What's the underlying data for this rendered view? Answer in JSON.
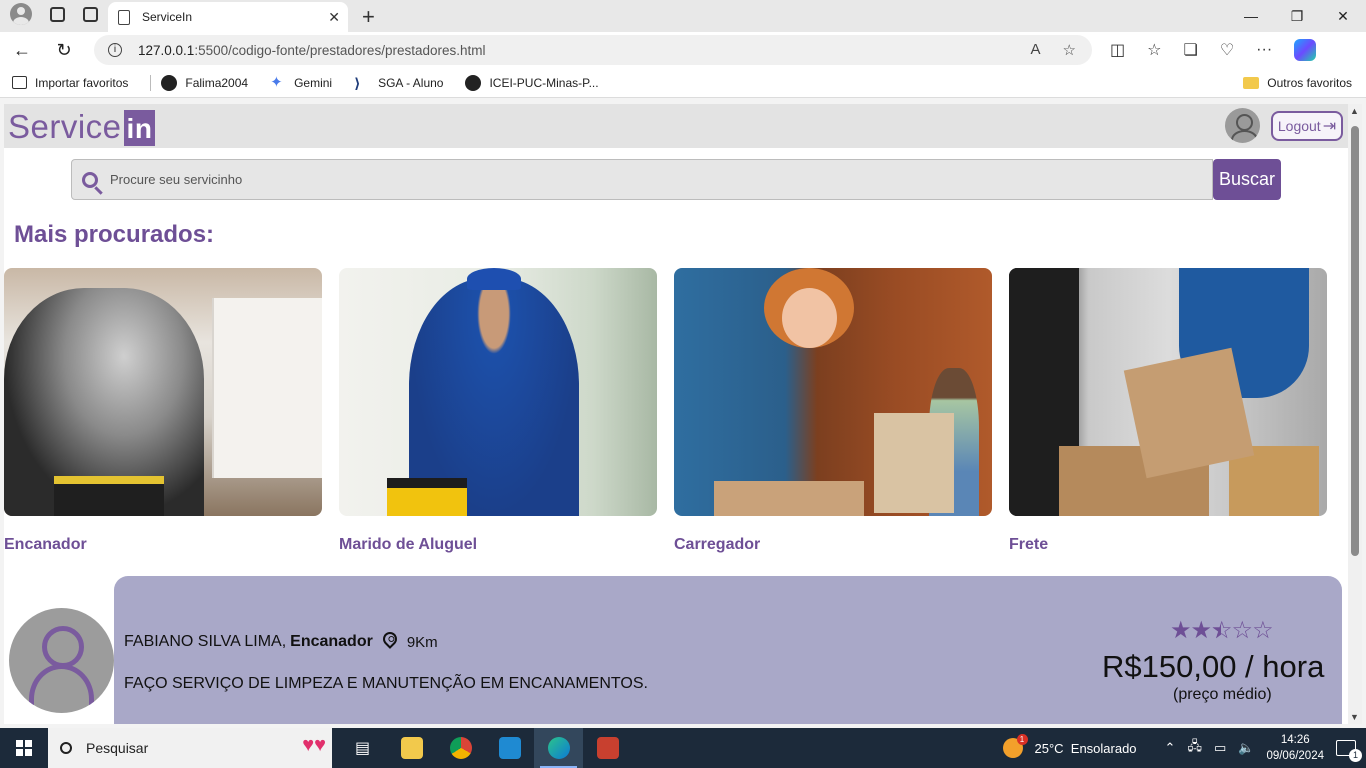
{
  "browser": {
    "tab_title": "ServiceIn",
    "url_host": "127.0.0.1",
    "url_rest": ":5500/codigo-fonte/prestadores/prestadores.html",
    "favorites": [
      {
        "label": "Importar favoritos",
        "icon": "import-icon"
      },
      {
        "label": "Falima2004",
        "icon": "github-icon"
      },
      {
        "label": "Gemini",
        "icon": "gemini-icon"
      },
      {
        "label": "SGA - Aluno",
        "icon": "sga-icon"
      },
      {
        "label": "ICEI-PUC-Minas-P...",
        "icon": "github-icon"
      }
    ],
    "other_favorites": "Outros favoritos"
  },
  "header": {
    "logo_text": "Service",
    "logo_suffix": "in",
    "logout_label": "Logout"
  },
  "search": {
    "placeholder": "Procure seu servicinho",
    "button_label": "Buscar"
  },
  "popular": {
    "title": "Mais procurados:",
    "items": [
      {
        "label": "Encanador"
      },
      {
        "label": "Marido de Aluguel"
      },
      {
        "label": "Carregador"
      },
      {
        "label": "Frete"
      }
    ]
  },
  "provider": {
    "name": "FABIANO SILVA LIMA,",
    "service": "Encanador",
    "distance": "9Km",
    "description": "FAÇO SERVIÇO DE LIMPEZA E MANUTENÇÃO EM ENCANAMENTOS.",
    "rating": 2.5,
    "rating_max": 5,
    "price": "R$150,00 / hora",
    "price_note": "(preço médio)"
  },
  "taskbar": {
    "search_label": "Pesquisar",
    "weather": "25°C  Ensolarado",
    "time": "14:26",
    "date": "09/06/2024",
    "weather_badge": "1",
    "notif_count": "1"
  },
  "colors": {
    "brand": "#6e4f96",
    "card_bg": "#a9a8c8"
  }
}
